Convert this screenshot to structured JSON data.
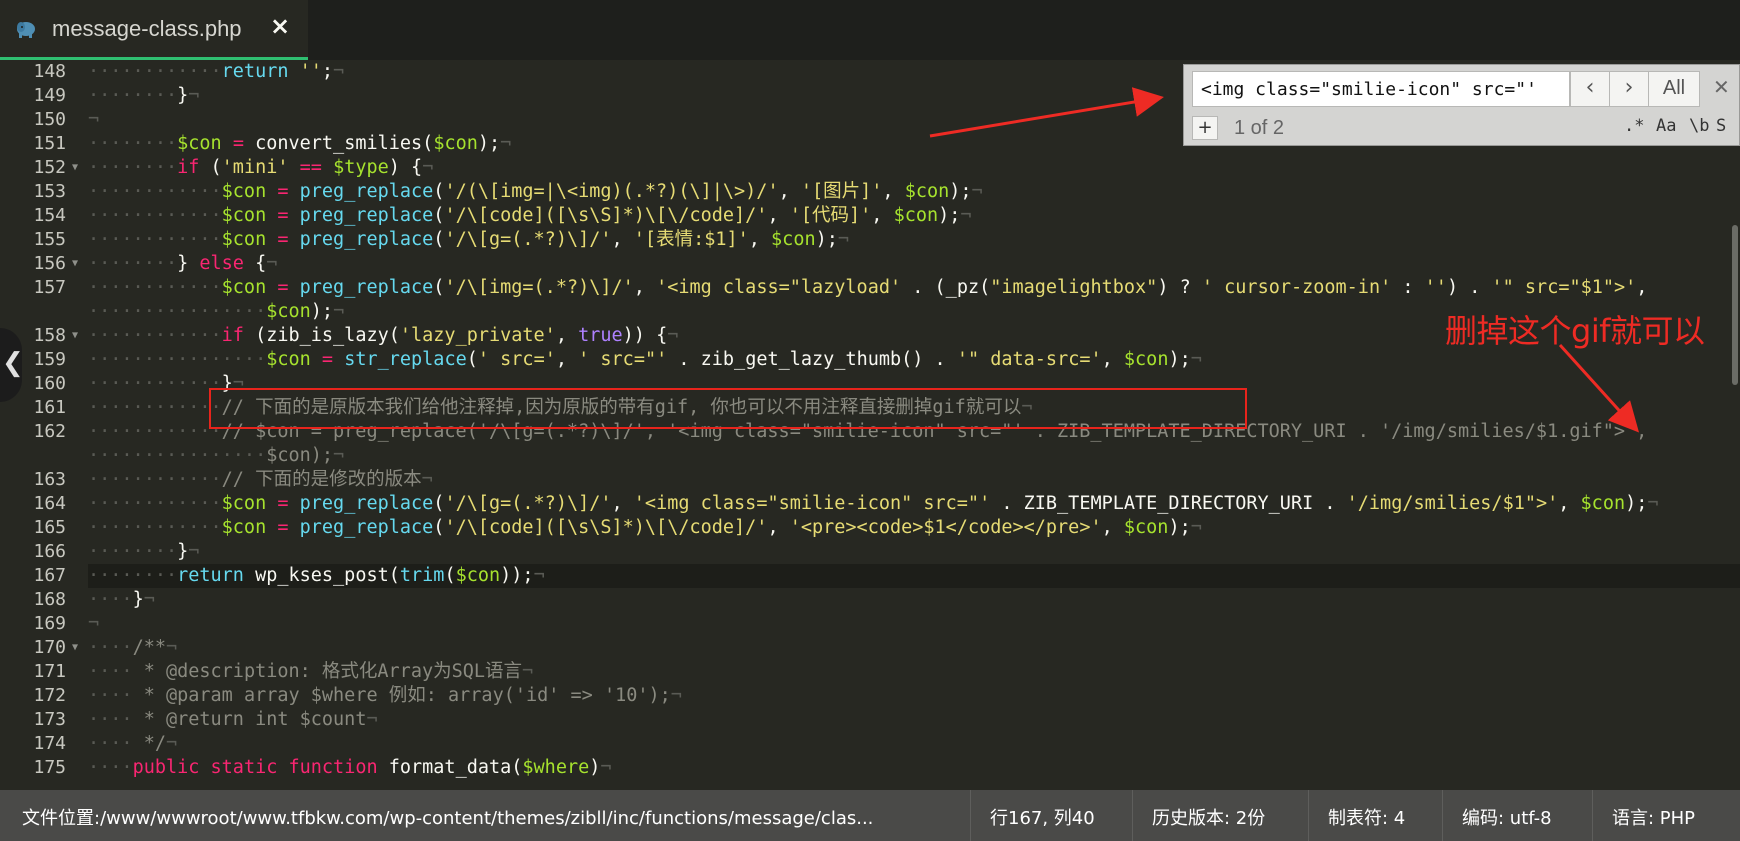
{
  "tab": {
    "title": "message-class.php",
    "icon": "elephant-php-icon",
    "close": "×"
  },
  "editor": {
    "current_line": "167",
    "lines": [
      {
        "n": "148",
        "fold": false,
        "code": [
          [
            "ws",
            "············"
          ],
          [
            "b",
            "return"
          ],
          [
            "f",
            " "
          ],
          [
            "s",
            "''"
          ],
          [
            "f",
            ";"
          ],
          [
            "ws",
            "¬"
          ]
        ]
      },
      {
        "n": "149",
        "fold": false,
        "code": [
          [
            "ws",
            "········"
          ],
          [
            "f",
            "}"
          ],
          [
            "ws",
            "¬"
          ]
        ]
      },
      {
        "n": "150",
        "fold": false,
        "code": [
          [
            "ws",
            "¬"
          ]
        ]
      },
      {
        "n": "151",
        "fold": false,
        "code": [
          [
            "ws",
            "········"
          ],
          [
            "v",
            "$con"
          ],
          [
            "f",
            " "
          ],
          [
            "o",
            "="
          ],
          [
            "f",
            " convert_smilies("
          ],
          [
            "v",
            "$con"
          ],
          [
            "f",
            ");"
          ],
          [
            "ws",
            "¬"
          ]
        ]
      },
      {
        "n": "152",
        "fold": true,
        "code": [
          [
            "ws",
            "········"
          ],
          [
            "k",
            "if"
          ],
          [
            "f",
            " ("
          ],
          [
            "s",
            "'mini'"
          ],
          [
            "f",
            " "
          ],
          [
            "o",
            "=="
          ],
          [
            "f",
            " "
          ],
          [
            "v",
            "$type"
          ],
          [
            "f",
            ") {"
          ],
          [
            "ws",
            "¬"
          ]
        ]
      },
      {
        "n": "153",
        "fold": false,
        "code": [
          [
            "ws",
            "············"
          ],
          [
            "v",
            "$con"
          ],
          [
            "f",
            " "
          ],
          [
            "o",
            "="
          ],
          [
            "f",
            " "
          ],
          [
            "b",
            "preg_replace"
          ],
          [
            "f",
            "("
          ],
          [
            "s",
            "'/(\\[img=|\\<img)(.*?)(\\]|\\>)/'"
          ],
          [
            "f",
            ", "
          ],
          [
            "s",
            "'[图片]'"
          ],
          [
            "f",
            ", "
          ],
          [
            "v",
            "$con"
          ],
          [
            "f",
            ");"
          ],
          [
            "ws",
            "¬"
          ]
        ]
      },
      {
        "n": "154",
        "fold": false,
        "code": [
          [
            "ws",
            "············"
          ],
          [
            "v",
            "$con"
          ],
          [
            "f",
            " "
          ],
          [
            "o",
            "="
          ],
          [
            "f",
            " "
          ],
          [
            "b",
            "preg_replace"
          ],
          [
            "f",
            "("
          ],
          [
            "s",
            "'/\\[code]([\\s\\S]*)\\[\\/code]/'"
          ],
          [
            "f",
            ", "
          ],
          [
            "s",
            "'[代码]'"
          ],
          [
            "f",
            ", "
          ],
          [
            "v",
            "$con"
          ],
          [
            "f",
            ");"
          ],
          [
            "ws",
            "¬"
          ]
        ]
      },
      {
        "n": "155",
        "fold": false,
        "code": [
          [
            "ws",
            "············"
          ],
          [
            "v",
            "$con"
          ],
          [
            "f",
            " "
          ],
          [
            "o",
            "="
          ],
          [
            "f",
            " "
          ],
          [
            "b",
            "preg_replace"
          ],
          [
            "f",
            "("
          ],
          [
            "s",
            "'/\\[g=(.*?)\\]/'"
          ],
          [
            "f",
            ", "
          ],
          [
            "s",
            "'[表情:$1]'"
          ],
          [
            "f",
            ", "
          ],
          [
            "v",
            "$con"
          ],
          [
            "f",
            ");"
          ],
          [
            "ws",
            "¬"
          ]
        ]
      },
      {
        "n": "156",
        "fold": true,
        "code": [
          [
            "ws",
            "········"
          ],
          [
            "f",
            "} "
          ],
          [
            "k",
            "else"
          ],
          [
            "f",
            " {"
          ],
          [
            "ws",
            "¬"
          ]
        ]
      },
      {
        "n": "157",
        "fold": false,
        "code": [
          [
            "ws",
            "············"
          ],
          [
            "v",
            "$con"
          ],
          [
            "f",
            " "
          ],
          [
            "o",
            "="
          ],
          [
            "f",
            " "
          ],
          [
            "b",
            "preg_replace"
          ],
          [
            "f",
            "("
          ],
          [
            "s",
            "'/\\[img=(.*?)\\]/'"
          ],
          [
            "f",
            ", "
          ],
          [
            "s",
            "'<img class=\"lazyload' "
          ],
          [
            "f",
            ". (_pz("
          ],
          [
            "s",
            "\"imagelightbox\""
          ],
          [
            "f",
            ") ? "
          ],
          [
            "s",
            "' cursor-zoom-in'"
          ],
          [
            "f",
            " : "
          ],
          [
            "s",
            "''"
          ],
          [
            "f",
            ") . "
          ],
          [
            "s",
            "'\" src=\"$1\">'"
          ],
          [
            "f",
            ","
          ]
        ]
      },
      {
        "n": "",
        "fold": false,
        "code": [
          [
            "ws",
            "················"
          ],
          [
            "v",
            "$con"
          ],
          [
            "f",
            ");"
          ],
          [
            "ws",
            "¬"
          ]
        ]
      },
      {
        "n": "158",
        "fold": true,
        "code": [
          [
            "ws",
            "············"
          ],
          [
            "k",
            "if"
          ],
          [
            "f",
            " (zib_is_lazy("
          ],
          [
            "s",
            "'lazy_private'"
          ],
          [
            "f",
            ", "
          ],
          [
            "p",
            "true"
          ],
          [
            "f",
            ")) {"
          ],
          [
            "ws",
            "¬"
          ]
        ]
      },
      {
        "n": "159",
        "fold": false,
        "code": [
          [
            "ws",
            "················"
          ],
          [
            "v",
            "$con"
          ],
          [
            "f",
            " "
          ],
          [
            "o",
            "="
          ],
          [
            "f",
            " "
          ],
          [
            "b",
            "str_replace"
          ],
          [
            "f",
            "("
          ],
          [
            "s",
            "' src='"
          ],
          [
            "f",
            ", "
          ],
          [
            "s",
            "' src=\"'"
          ],
          [
            "f",
            " . zib_get_lazy_thumb() . "
          ],
          [
            "s",
            "'\" data-src='"
          ],
          [
            "f",
            ", "
          ],
          [
            "v",
            "$con"
          ],
          [
            "f",
            ");"
          ],
          [
            "ws",
            "¬"
          ]
        ]
      },
      {
        "n": "160",
        "fold": false,
        "code": [
          [
            "ws",
            "············"
          ],
          [
            "f",
            "}"
          ],
          [
            "ws",
            "¬"
          ]
        ]
      },
      {
        "n": "161",
        "fold": false,
        "code": [
          [
            "ws",
            "············"
          ],
          [
            "c",
            "// 下面的是原版本我们给他注释掉,因为原版的带有gif, 你也可以不用注释直接删掉gif就可以"
          ],
          [
            "ws",
            "¬"
          ]
        ]
      },
      {
        "n": "162",
        "fold": false,
        "code": [
          [
            "ws",
            "············"
          ],
          [
            "c",
            "// $con = preg_replace('/\\[g=(.*?)\\]/', '<img class=\"smilie-icon\" src=\"' . ZIB_TEMPLATE_DIRECTORY_URI . '/img/smilies/$1.gif\">',"
          ]
        ]
      },
      {
        "n": "",
        "fold": false,
        "code": [
          [
            "ws",
            "················"
          ],
          [
            "c",
            "$con);"
          ],
          [
            "ws",
            "¬"
          ]
        ]
      },
      {
        "n": "163",
        "fold": false,
        "code": [
          [
            "ws",
            "············"
          ],
          [
            "c",
            "// 下面的是修改的版本"
          ],
          [
            "ws",
            "¬"
          ]
        ]
      },
      {
        "n": "164",
        "fold": false,
        "code": [
          [
            "ws",
            "············"
          ],
          [
            "v",
            "$con"
          ],
          [
            "f",
            " "
          ],
          [
            "o",
            "="
          ],
          [
            "f",
            " "
          ],
          [
            "b",
            "preg_replace"
          ],
          [
            "f",
            "("
          ],
          [
            "s",
            "'/\\[g=(.*?)\\]/'"
          ],
          [
            "f",
            ", "
          ],
          [
            "s",
            "'<img class=\"smilie-icon\" src=\"'"
          ],
          [
            "f",
            " . ZIB_TEMPLATE_DIRECTORY_URI . "
          ],
          [
            "s",
            "'/img/smilies/$1\">'"
          ],
          [
            "f",
            ", "
          ],
          [
            "v",
            "$con"
          ],
          [
            "f",
            ");"
          ],
          [
            "ws",
            "¬"
          ]
        ]
      },
      {
        "n": "165",
        "fold": false,
        "code": [
          [
            "ws",
            "············"
          ],
          [
            "v",
            "$con"
          ],
          [
            "f",
            " "
          ],
          [
            "o",
            "="
          ],
          [
            "f",
            " "
          ],
          [
            "b",
            "preg_replace"
          ],
          [
            "f",
            "("
          ],
          [
            "s",
            "'/\\[code]([\\s\\S]*)\\[\\/code]/'"
          ],
          [
            "f",
            ", "
          ],
          [
            "s",
            "'<pre><code>$1</code></pre>'"
          ],
          [
            "f",
            ", "
          ],
          [
            "v",
            "$con"
          ],
          [
            "f",
            ");"
          ],
          [
            "ws",
            "¬"
          ]
        ]
      },
      {
        "n": "166",
        "fold": false,
        "code": [
          [
            "ws",
            "········"
          ],
          [
            "f",
            "}"
          ],
          [
            "ws",
            "¬"
          ]
        ]
      },
      {
        "n": "167",
        "fold": false,
        "code": [
          [
            "ws",
            "········"
          ],
          [
            "b",
            "return"
          ],
          [
            "f",
            " wp_kses_post("
          ],
          [
            "b",
            "trim"
          ],
          [
            "f",
            "("
          ],
          [
            "v",
            "$con"
          ],
          [
            "f",
            "));"
          ],
          [
            "ws",
            "¬"
          ]
        ]
      },
      {
        "n": "168",
        "fold": false,
        "code": [
          [
            "ws",
            "····"
          ],
          [
            "f",
            "}"
          ],
          [
            "ws",
            "¬"
          ]
        ]
      },
      {
        "n": "169",
        "fold": false,
        "code": [
          [
            "ws",
            "¬"
          ]
        ]
      },
      {
        "n": "170",
        "fold": true,
        "code": [
          [
            "ws",
            "····"
          ],
          [
            "c",
            "/**"
          ],
          [
            "ws",
            "¬"
          ]
        ]
      },
      {
        "n": "171",
        "fold": false,
        "code": [
          [
            "ws",
            "····"
          ],
          [
            "c",
            " * @description: 格式化Array为SQL语言"
          ],
          [
            "ws",
            "¬"
          ]
        ]
      },
      {
        "n": "172",
        "fold": false,
        "code": [
          [
            "ws",
            "····"
          ],
          [
            "c",
            " * @param array $where 例如: array('id' => '10');"
          ],
          [
            "ws",
            "¬"
          ]
        ]
      },
      {
        "n": "173",
        "fold": false,
        "code": [
          [
            "ws",
            "····"
          ],
          [
            "c",
            " * @return int $count"
          ],
          [
            "ws",
            "¬"
          ]
        ]
      },
      {
        "n": "174",
        "fold": false,
        "code": [
          [
            "ws",
            "····"
          ],
          [
            "c",
            " */"
          ],
          [
            "ws",
            "¬"
          ]
        ]
      },
      {
        "n": "175",
        "fold": false,
        "code": [
          [
            "ws",
            "····"
          ],
          [
            "k",
            "public"
          ],
          [
            "f",
            " "
          ],
          [
            "k",
            "static"
          ],
          [
            "f",
            " "
          ],
          [
            "k",
            "function"
          ],
          [
            "f",
            " format_data("
          ],
          [
            "v",
            "$where"
          ],
          [
            "f",
            ")"
          ],
          [
            "ws",
            "¬"
          ]
        ]
      }
    ]
  },
  "find": {
    "query": "<img class=\"smilie-icon\" src=\"'",
    "prev_icon": "chevron-left-icon",
    "next_icon": "chevron-right-icon",
    "all_label": "All",
    "close": "✕",
    "add": "+",
    "count": "1 of 2",
    "opt_regex": ".*",
    "opt_case": "Aa",
    "opt_word": "\\b",
    "opt_s": "S"
  },
  "annotation": {
    "text": "删掉这个gif就可以",
    "color": "#ee2b24"
  },
  "status": {
    "path_label": "文件位置:",
    "path": "/www/wwwroot/www.tfbkw.com/wp-content/themes/zibll/inc/functions/message/clas...",
    "position": "行167, 列40",
    "history": "历史版本: 2份",
    "tab_size": "制表符: 4",
    "encoding": "编码: utf-8",
    "language": "语言: PHP"
  },
  "colors": {
    "background": "#272822",
    "variable": "#a6e22e",
    "keyword": "#f92672",
    "string": "#e6db74",
    "builtin": "#66d9ef",
    "comment": "#8a8a80",
    "tab_active_border": "#2fbf71"
  }
}
